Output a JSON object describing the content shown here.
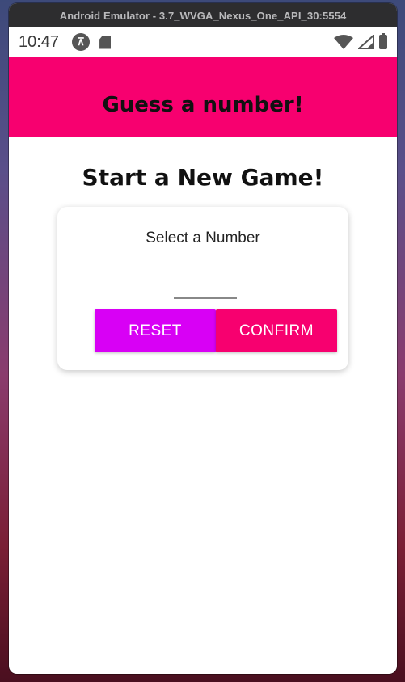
{
  "window": {
    "title": "Android Emulator - 3.7_WVGA_Nexus_One_API_30:5554"
  },
  "statusbar": {
    "time": "10:47",
    "left_icons": [
      "app-badge-icon",
      "sd-card-icon"
    ],
    "right_icons": [
      "wifi-icon",
      "signal-icon",
      "battery-icon"
    ]
  },
  "header": {
    "title": "Guess a number!"
  },
  "screen": {
    "title": "Start a New Game!",
    "card": {
      "label": "Select a Number",
      "input_value": "",
      "reset_label": "RESET",
      "confirm_label": "CONFIRM"
    }
  },
  "colors": {
    "accent": "#f7006f",
    "secondary": "#d800f5"
  }
}
